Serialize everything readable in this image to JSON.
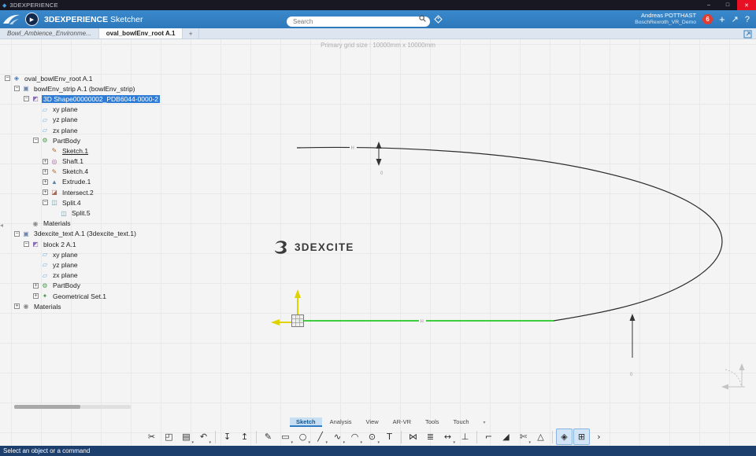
{
  "titlebar": {
    "title": "3DEXPERIENCE",
    "controls": [
      {
        "name": "minimize-button",
        "glyph": "–"
      },
      {
        "name": "maximize-button",
        "glyph": "□"
      },
      {
        "name": "close-button",
        "glyph": "✕",
        "close": true
      }
    ]
  },
  "header": {
    "app_bold": "3DEXPERIENCE",
    "app_name": " Sketcher",
    "search_placeholder": "Search",
    "user_name": "Andreas POTTHAST",
    "workspace": "BoschRexroth_VR_Demo",
    "badge_count": "6",
    "plus_label": "+",
    "share_glyph": "↗",
    "help_glyph": "?"
  },
  "doc_tabs": {
    "items": [
      {
        "label": "Bowl_Ambience_Environme...",
        "active": false,
        "italic": true
      },
      {
        "label": "oval_bowlEnv_root A.1",
        "active": true,
        "italic": false
      }
    ],
    "add_label": "+"
  },
  "canvas": {
    "grid_caption": "Primary grid size : 10000mm x 10000mm",
    "watermark_text": "3DEXCITE",
    "dim_top_label": "0",
    "dim_right_label": "0",
    "h_axis_label": "H",
    "h_top_label": "H",
    "accent_green": "#00c000",
    "accent_yellow": "#ded300"
  },
  "tree": {
    "icon_defs": {
      "root": {
        "glyph": "◈",
        "color": "#4a78b0"
      },
      "product": {
        "glyph": "▣",
        "color": "#6f87ad"
      },
      "shape": {
        "glyph": "◩",
        "color": "#8d6fb3"
      },
      "plane": {
        "glyph": "▱",
        "color": "#5fa0dc"
      },
      "partbody": {
        "glyph": "⚙",
        "color": "#4c9a4c"
      },
      "sketch": {
        "glyph": "✎",
        "color": "#b06a32"
      },
      "shaft": {
        "glyph": "◎",
        "color": "#a85f9e"
      },
      "extrude": {
        "glyph": "▲",
        "color": "#5f83a8"
      },
      "intersect": {
        "glyph": "◪",
        "color": "#a86a5f"
      },
      "split": {
        "glyph": "◫",
        "color": "#5f9ea8"
      },
      "materials": {
        "glyph": "◉",
        "color": "#8a8a8a"
      },
      "geoset": {
        "glyph": "✦",
        "color": "#4c9a4c"
      }
    },
    "items": [
      {
        "label": "oval_bowlEnv_root A.1",
        "depth": 0,
        "icon": "root",
        "exp": "minus"
      },
      {
        "label": "bowlEnv_strip A.1 (bowlEnv_strip)",
        "depth": 1,
        "icon": "product",
        "exp": "minus"
      },
      {
        "label": "3D Shape00000002_PDB6044-0000-2",
        "depth": 2,
        "icon": "shape",
        "exp": "minus",
        "selected": true
      },
      {
        "label": "xy plane",
        "depth": 3,
        "icon": "plane"
      },
      {
        "label": "yz plane",
        "depth": 3,
        "icon": "plane"
      },
      {
        "label": "zx plane",
        "depth": 3,
        "icon": "plane"
      },
      {
        "label": "PartBody",
        "depth": 3,
        "icon": "partbody",
        "exp": "minus"
      },
      {
        "label": "Sketch.1",
        "depth": 4,
        "icon": "sketch",
        "underline": true
      },
      {
        "label": "Shaft.1",
        "depth": 4,
        "icon": "shaft",
        "exp": "plus"
      },
      {
        "label": "Sketch.4",
        "depth": 4,
        "icon": "sketch",
        "exp": "plus"
      },
      {
        "label": "Extrude.1",
        "depth": 4,
        "icon": "extrude",
        "exp": "plus"
      },
      {
        "label": "Intersect.2",
        "depth": 4,
        "icon": "intersect",
        "exp": "plus"
      },
      {
        "label": "Split.4",
        "depth": 4,
        "icon": "split",
        "exp": "minus"
      },
      {
        "label": "Split.5",
        "depth": 5,
        "icon": "split"
      },
      {
        "label": "Materials",
        "depth": 2,
        "icon": "materials"
      },
      {
        "label": "3dexcite_text A.1 (3dexcite_text.1)",
        "depth": 1,
        "icon": "product",
        "exp": "minus"
      },
      {
        "label": "block 2 A.1",
        "depth": 2,
        "icon": "shape",
        "exp": "minus"
      },
      {
        "label": "xy plane",
        "depth": 3,
        "icon": "plane"
      },
      {
        "label": "yz plane",
        "depth": 3,
        "icon": "plane"
      },
      {
        "label": "zx plane",
        "depth": 3,
        "icon": "plane"
      },
      {
        "label": "PartBody",
        "depth": 3,
        "icon": "partbody",
        "exp": "plus"
      },
      {
        "label": "Geometrical Set.1",
        "depth": 3,
        "icon": "geoset",
        "exp": "plus"
      },
      {
        "label": "Materials",
        "depth": 1,
        "icon": "materials",
        "exp": "plus"
      }
    ]
  },
  "bottom_tabs": {
    "items": [
      {
        "label": "Sketch",
        "active": true
      },
      {
        "label": "Analysis",
        "active": false
      },
      {
        "label": "View",
        "active": false
      },
      {
        "label": "AR-VR",
        "active": false
      },
      {
        "label": "Tools",
        "active": false
      },
      {
        "label": "Touch",
        "active": false
      }
    ]
  },
  "toolbar": {
    "items": [
      {
        "name": "cut",
        "glyph": "✂"
      },
      {
        "name": "copy",
        "glyph": "◰"
      },
      {
        "name": "paste",
        "glyph": "▤",
        "caret": true
      },
      {
        "name": "undo",
        "glyph": "↶",
        "caret": true
      },
      {
        "type": "divider"
      },
      {
        "name": "exit-app",
        "glyph": "↧"
      },
      {
        "name": "export",
        "glyph": "↥"
      },
      {
        "type": "divider"
      },
      {
        "name": "profile",
        "glyph": "✎"
      },
      {
        "name": "rectangle",
        "glyph": "▭",
        "caret": true
      },
      {
        "name": "circle",
        "glyph": "○",
        "caret": true
      },
      {
        "name": "line",
        "glyph": "╱",
        "caret": true
      },
      {
        "name": "spline",
        "glyph": "∿",
        "caret": true
      },
      {
        "name": "arc",
        "glyph": "◠",
        "caret": true
      },
      {
        "name": "point",
        "glyph": "⊙",
        "caret": true
      },
      {
        "name": "text",
        "glyph": "T"
      },
      {
        "type": "divider"
      },
      {
        "name": "mirror",
        "glyph": "⋈"
      },
      {
        "name": "offset",
        "glyph": "≣"
      },
      {
        "name": "dimension",
        "glyph": "↔",
        "caret": true
      },
      {
        "name": "constraint",
        "glyph": "⊥"
      },
      {
        "type": "divider"
      },
      {
        "name": "corner",
        "glyph": "⌐"
      },
      {
        "name": "chamfer",
        "glyph": "◢"
      },
      {
        "name": "trim",
        "glyph": "✄",
        "caret": true
      },
      {
        "name": "analysis",
        "glyph": "△"
      },
      {
        "type": "divider"
      },
      {
        "name": "snap-to-point",
        "glyph": "◈",
        "active": true
      },
      {
        "name": "sketch-grid",
        "glyph": "⊞",
        "active": true
      },
      {
        "name": "more-tools",
        "glyph": "›"
      }
    ]
  },
  "statusbar": {
    "message": "Select an object or a command"
  }
}
